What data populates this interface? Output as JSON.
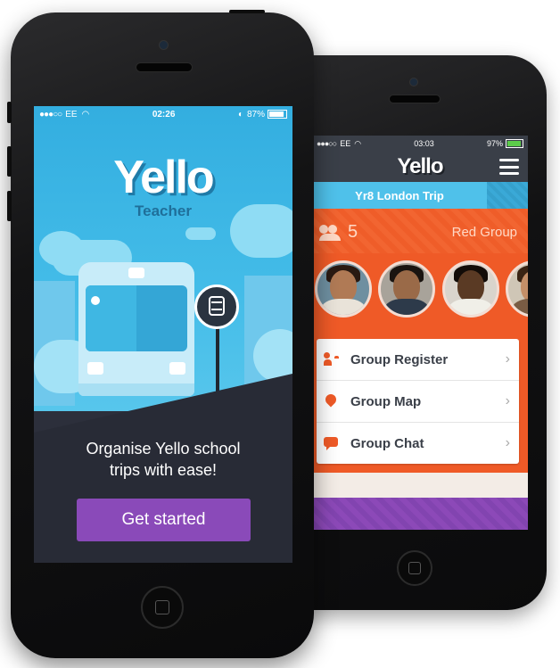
{
  "back_phone": {
    "status_bar": {
      "carrier": "EE",
      "time": "03:03",
      "battery": "97%"
    },
    "app_logo": "Yello",
    "trip_title": "Yr8 London Trip",
    "group": {
      "member_count": "5",
      "name": "Red Group"
    },
    "menu_items": [
      {
        "label": "Group Register",
        "icon": "register-icon"
      },
      {
        "label": "Group Map",
        "icon": "map-pin-icon"
      },
      {
        "label": "Group Chat",
        "icon": "chat-icon"
      }
    ],
    "colors": {
      "nav": "#3a3f48",
      "trip_bar": "#4fc1ea",
      "group": "#ef5a27",
      "next_group": "#8c49b8"
    }
  },
  "front_phone": {
    "status_bar": {
      "carrier": "EE",
      "time": "02:26",
      "battery": "87%"
    },
    "app_logo": "Yello",
    "app_subtitle": "Teacher",
    "tagline": "Organise Yello school\ntrips with ease!",
    "cta_label": "Get started",
    "colors": {
      "sky": "#43bce8",
      "ground": "#282b36",
      "cta": "#8a4ab9"
    }
  }
}
